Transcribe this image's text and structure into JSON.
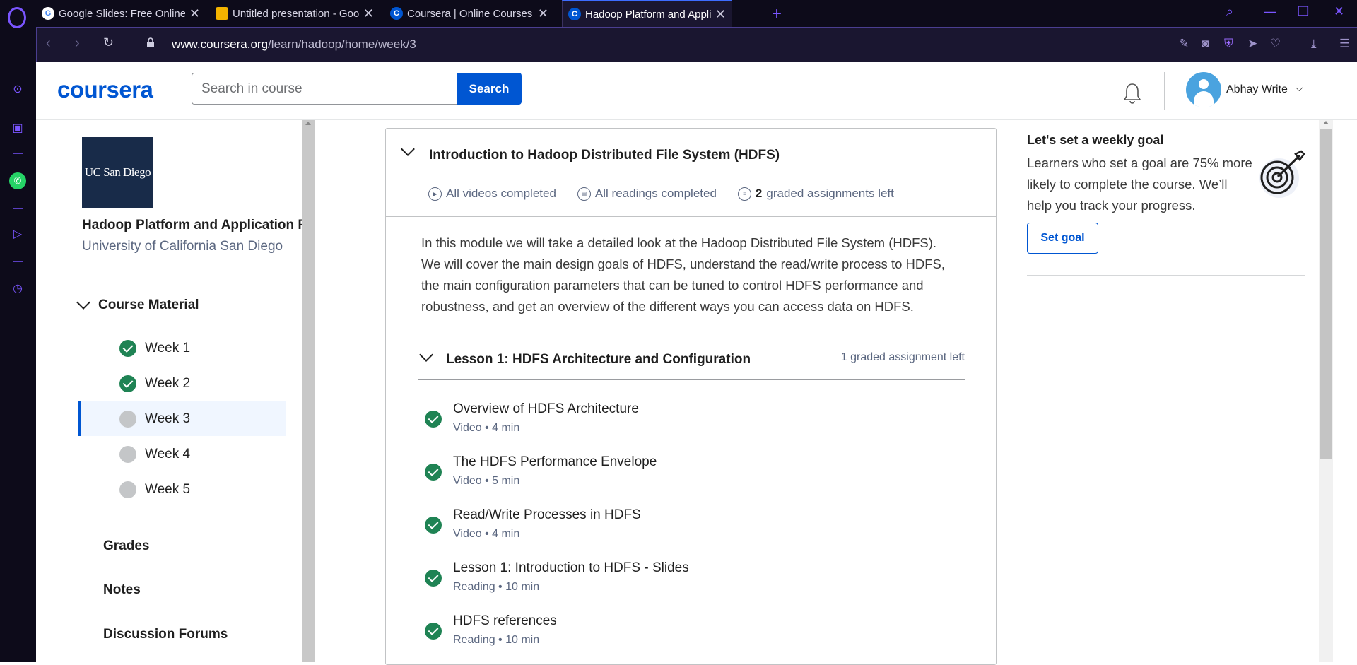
{
  "browser": {
    "tabs": [
      {
        "title": "Google Slides: Free Online",
        "favicon": "google-icon"
      },
      {
        "title": "Untitled presentation - Goo",
        "favicon": "slides-icon"
      },
      {
        "title": "Coursera | Online Courses &",
        "favicon": "coursera-icon"
      },
      {
        "title": "Hadoop Platform and Appli",
        "favicon": "coursera-icon",
        "active": true
      }
    ],
    "url_host": "www.coursera.org",
    "url_path": "/learn/hadoop/home/week/3"
  },
  "header": {
    "logo": "coursera",
    "search_placeholder": "Search in course",
    "search_label": "Search",
    "user_name": "Abhay Write"
  },
  "course": {
    "partner_logo": "UC San Diego",
    "title": "Hadoop Platform and Application Framework",
    "university": "University of California San Diego",
    "material_label": "Course Material",
    "weeks": [
      {
        "label": "Week 1",
        "status": "completed"
      },
      {
        "label": "Week 2",
        "status": "completed"
      },
      {
        "label": "Week 3",
        "status": "current"
      },
      {
        "label": "Week 4",
        "status": "incomplete"
      },
      {
        "label": "Week 5",
        "status": "incomplete"
      }
    ],
    "nav_links": [
      "Grades",
      "Notes",
      "Discussion Forums"
    ]
  },
  "module": {
    "title": "Introduction to Hadoop Distributed File System (HDFS)",
    "stats": {
      "videos": "All videos completed",
      "readings": "All readings completed",
      "graded_count": "2",
      "graded_suffix": "graded assignments left"
    },
    "description": "In this module we will take a detailed look at the Hadoop Distributed File System (HDFS). We will cover the main design goals of HDFS, understand the read/write process to HDFS, the main configuration parameters that can be tuned to control HDFS performance and robustness, and get an overview of the different ways you can access data on HDFS.",
    "lesson": {
      "title": "Lesson 1: HDFS Architecture and Configuration",
      "meta": "1 graded assignment left",
      "items": [
        {
          "title": "Overview of HDFS Architecture",
          "meta": "Video • 4 min"
        },
        {
          "title": "The HDFS Performance Envelope",
          "meta": "Video • 5 min"
        },
        {
          "title": "Read/Write Processes in HDFS",
          "meta": "Video • 4 min"
        },
        {
          "title": "Lesson 1: Introduction to HDFS - Slides",
          "meta": "Reading • 10 min"
        },
        {
          "title": "HDFS references",
          "meta": "Reading • 10 min"
        }
      ]
    }
  },
  "goal": {
    "title": "Let's set a weekly goal",
    "text": "Learners who set a goal are 75% more likely to complete the course. We’ll help you track your progress.",
    "button": "Set goal"
  }
}
